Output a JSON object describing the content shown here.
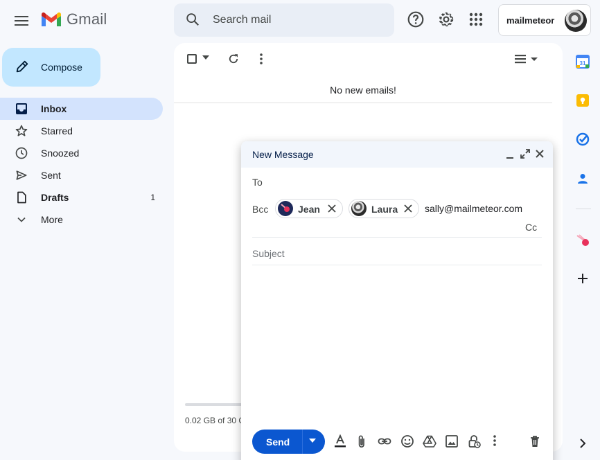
{
  "app": {
    "name": "Gmail"
  },
  "search": {
    "placeholder": "Search mail"
  },
  "account": {
    "label": "mailmeteor"
  },
  "compose_button": {
    "label": "Compose"
  },
  "nav": {
    "items": [
      {
        "label": "Inbox",
        "icon": "inbox-icon"
      },
      {
        "label": "Starred",
        "icon": "star-icon"
      },
      {
        "label": "Snoozed",
        "icon": "clock-icon"
      },
      {
        "label": "Sent",
        "icon": "send-icon"
      },
      {
        "label": "Drafts",
        "icon": "draft-icon",
        "count": "1"
      },
      {
        "label": "More",
        "icon": "chevron-down-icon"
      }
    ]
  },
  "main": {
    "empty_message": "No new emails!",
    "storage_text": "0.02 GB of 30 G"
  },
  "composer": {
    "title": "New Message",
    "to_label": "To",
    "bcc_label": "Bcc",
    "recipients": [
      {
        "name": "Jean"
      },
      {
        "name": "Laura"
      }
    ],
    "bcc_input": "sally@mailmeteor.com",
    "cc_label": "Cc",
    "subject_placeholder": "Subject",
    "send_label": "Send"
  },
  "colors": {
    "accent": "#0b57d0",
    "compose_bg": "#c2e7ff",
    "active_nav": "#d3e3fd",
    "page_bg": "#f6f8fc"
  }
}
